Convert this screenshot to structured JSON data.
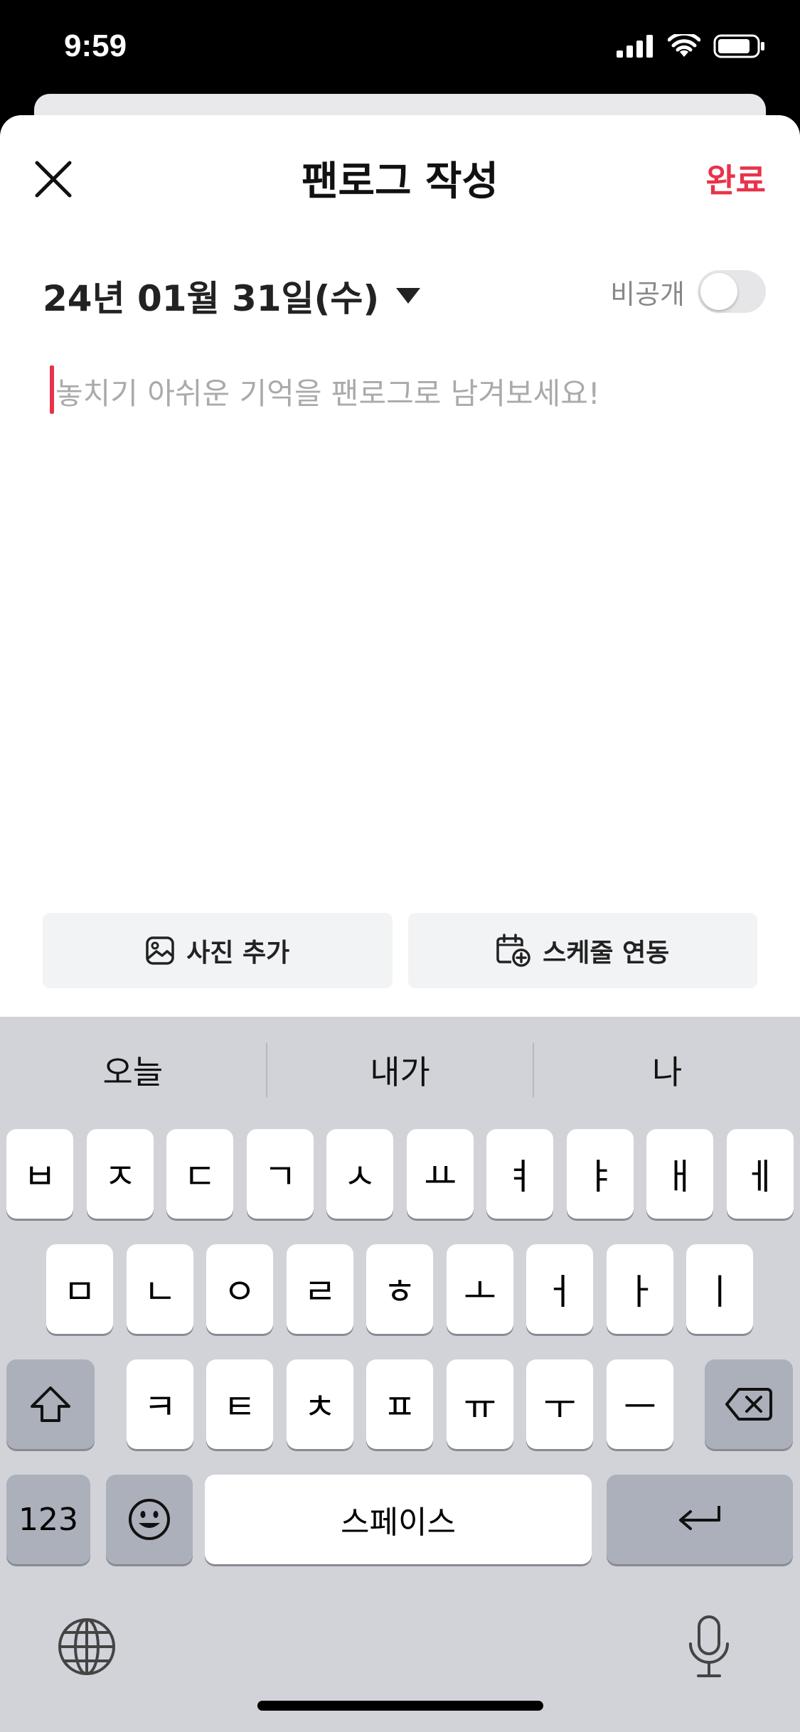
{
  "status_bar": {
    "time": "9:59"
  },
  "header": {
    "title": "팬로그 작성",
    "done_label": "완료"
  },
  "date_selector": {
    "date": "24년 01월 31일(수)"
  },
  "privacy": {
    "label": "비공개",
    "enabled": false
  },
  "editor": {
    "placeholder": "놓치기 아쉬운 기억을 팬로그로 남겨보세요!"
  },
  "actions": [
    {
      "label": "사진 추가",
      "icon": "image-icon"
    },
    {
      "label": "스케줄 연동",
      "icon": "calendar-add-icon"
    }
  ],
  "keyboard": {
    "suggestions": [
      "오늘",
      "내가",
      "나"
    ],
    "row1": [
      "ㅂ",
      "ㅈ",
      "ㄷ",
      "ㄱ",
      "ㅅ",
      "ㅛ",
      "ㅕ",
      "ㅑ",
      "ㅐ",
      "ㅔ"
    ],
    "row2": [
      "ㅁ",
      "ㄴ",
      "ㅇ",
      "ㄹ",
      "ㅎ",
      "ㅗ",
      "ㅓ",
      "ㅏ",
      "ㅣ"
    ],
    "row3": [
      "ㅋ",
      "ㅌ",
      "ㅊ",
      "ㅍ",
      "ㅠ",
      "ㅜ",
      "ㅡ"
    ],
    "numbers_label": "123",
    "space_label": "스페이스"
  },
  "colors": {
    "accent": "#e8334a",
    "keyboard_bg": "#d1d3d9"
  }
}
